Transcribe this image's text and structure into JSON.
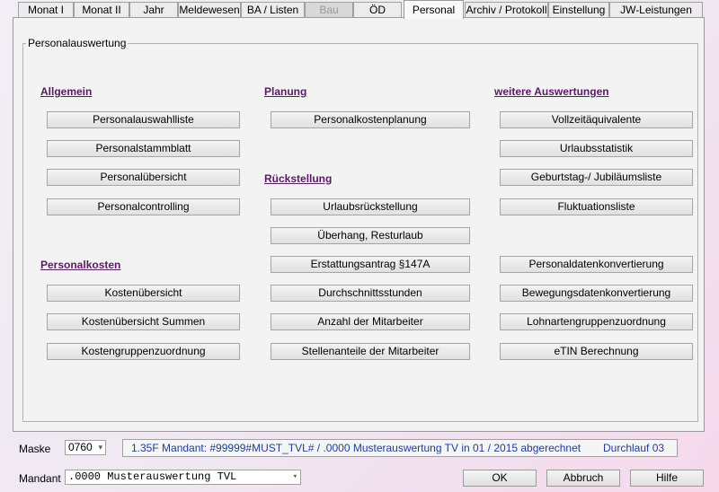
{
  "tabs": [
    "Monat I",
    "Monat II",
    "Jahr",
    "Meldewesen",
    "BA / Listen",
    "Bau",
    "ÖD",
    "Personal",
    "Archiv / Protokoll",
    "Einstellung",
    "JW-Leistungen"
  ],
  "group_title": "Personalauswertung",
  "sections": {
    "allgemein": {
      "title": "Allgemein",
      "buttons": [
        "Personalauswahlliste",
        "Personalstammblatt",
        "Personalübersicht",
        "Personalcontrolling"
      ]
    },
    "personalkosten": {
      "title": "Personalkosten",
      "buttons": [
        "Kostenübersicht",
        "Kostenübersicht Summen",
        "Kostengruppenzuordnung"
      ]
    },
    "planung": {
      "title": "Planung",
      "buttons": [
        "Personalkostenplanung"
      ]
    },
    "rueckstellung": {
      "title": "Rückstellung",
      "buttons": [
        "Urlaubsrückstellung",
        "Überhang, Resturlaub",
        "Erstattungsantrag §147A",
        "Durchschnittsstunden",
        "Anzahl der Mitarbeiter",
        "Stellenanteile der Mitarbeiter"
      ]
    },
    "weitere": {
      "title": "weitere Auswertungen",
      "buttons": [
        "Vollzeitäquivalente",
        "Urlaubsstatistik",
        "Geburtstag-/ Jubiläumsliste",
        "Fluktuationsliste",
        "Personaldatenkonvertierung",
        "Bewegungsdatenkonvertierung",
        "Lohnartengruppenzuordnung",
        "eTIN Berechnung"
      ]
    }
  },
  "footer": {
    "maske_label": "Maske",
    "maske_value": "0760",
    "status_text": "1.35F Mandant: #99999#MUST_TVL# / .0000 Musterauswertung TV in 01 / 2015 abgerechnet",
    "durchlauf": "Durchlauf 03",
    "mandant_label": "Mandant",
    "mandant_value": ".0000 Musterauswertung TVL",
    "ok": "OK",
    "abbruch": "Abbruch",
    "hilfe": "Hilfe"
  }
}
